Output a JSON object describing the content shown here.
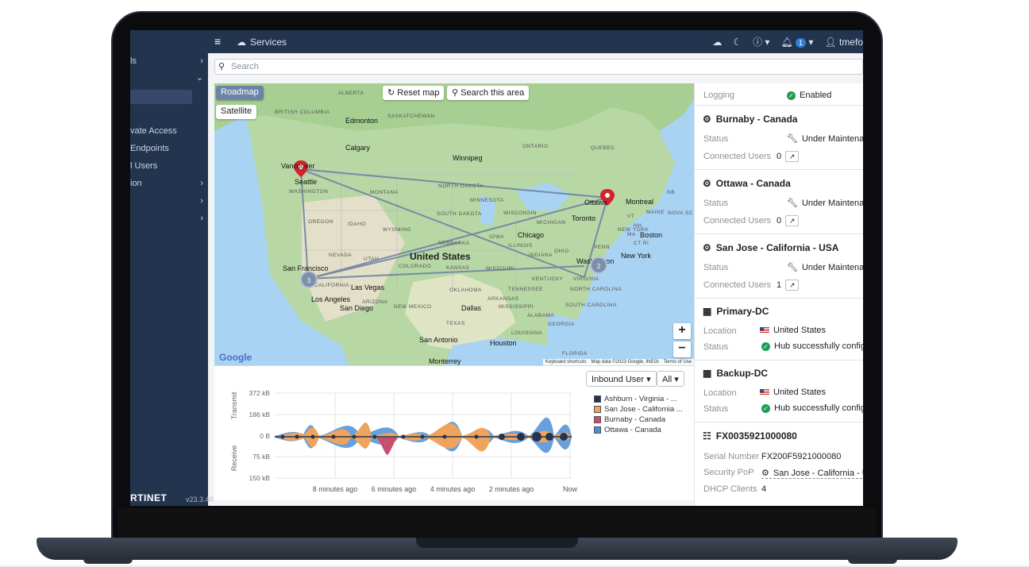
{
  "topbar": {
    "menu_icon": "hamburger-icon",
    "breadcrumb_icon": "cloud-icon",
    "breadcrumb": "Services",
    "notif_count": "1",
    "user": "tmefo"
  },
  "sidebar": {
    "items": [
      {
        "label": "ls",
        "chevron": "›"
      },
      {
        "label": "",
        "chevron": "⌄"
      },
      {
        "label": "vate Access",
        "chevron": ""
      },
      {
        "label": "Endpoints",
        "chevron": ""
      },
      {
        "label": "l Users",
        "chevron": ""
      },
      {
        "label": "ion",
        "chevron": "›"
      },
      {
        "label": "",
        "chevron": "›"
      },
      {
        "label": "",
        "chevron": "›"
      }
    ],
    "logo": "RTINET",
    "version": "v23.3.40"
  },
  "search": {
    "placeholder": "Search"
  },
  "map": {
    "roadmap": "Roadmap",
    "satellite": "Satellite",
    "reset": "Reset map",
    "search_area": "Search this area",
    "cluster_east": "2",
    "cluster_west": "3",
    "country": "United States",
    "cities": [
      "Vancouver",
      "Seattle",
      "Calgary",
      "Edmonton",
      "Winnipeg",
      "Ottawa",
      "Montreal",
      "Toronto",
      "Chicago",
      "Boston",
      "New York",
      "Washington",
      "San Francisco",
      "Las Vegas",
      "Los Angeles",
      "San Diego",
      "Dallas",
      "Houston",
      "San Antonio",
      "Monterrey"
    ],
    "regions": [
      "ALBERTA",
      "BRITISH COLUMBIA",
      "SASKATCHEWAN",
      "ONTARIO",
      "QUEBEC",
      "NORTH DAKOTA",
      "MINNESOTA",
      "MONTANA",
      "WASHINGTON",
      "OREGON",
      "IDAHO",
      "WYOMING",
      "SOUTH DAKOTA",
      "WISCONSIN",
      "MICHIGAN",
      "NEBRASKA",
      "IOWA",
      "ILLINOIS",
      "INDIANA",
      "OHIO",
      "PENN",
      "NEVADA",
      "UTAH",
      "COLORADO",
      "KANSAS",
      "MISSOURI",
      "KENTUCKY",
      "VIRGINIA",
      "ARIZONA",
      "NEW MEXICO",
      "OKLAHOMA",
      "ARKANSAS",
      "TENNESSEE",
      "NORTH CAROLINA",
      "SOUTH CAROLINA",
      "MISSISSIPPI",
      "ALABAMA",
      "GEORGIA",
      "TEXAS",
      "LOUISIANA",
      "FLORIDA",
      "CALIFORNIA",
      "NEW YORK",
      "MAINE",
      "NOVA SC",
      "VT",
      "NH",
      "CT RI",
      "MA",
      "NB"
    ],
    "footer": {
      "shortcuts": "Keyboard shortcuts",
      "data": "Map data ©2023 Google, INEGI",
      "terms": "Terms of Use"
    },
    "google": "Google"
  },
  "chart_controls": {
    "filter": "Inbound User ▾",
    "scope": "All ▾"
  },
  "chart_data": {
    "type": "area",
    "ylabel_top": "Transmit",
    "ylabel_bottom": "Receive",
    "y_ticks": [
      "372 kB",
      "186 kB",
      "0 B",
      "75 kB",
      "150 kB"
    ],
    "x_ticks": [
      "8 minutes ago",
      "6 minutes ago",
      "4 minutes ago",
      "2 minutes ago",
      "Now"
    ],
    "legend": [
      {
        "name": "Ashburn - Virginia - ...",
        "color": "#23344f"
      },
      {
        "name": "San Jose - California ...",
        "color": "#f0a35b"
      },
      {
        "name": "Burnaby - Canada",
        "color": "#c84d70"
      },
      {
        "name": "Ottawa - Canada",
        "color": "#4d8fd6"
      }
    ]
  },
  "panel": {
    "logging": {
      "label": "Logging",
      "value": "Enabled"
    },
    "burnaby": {
      "title": "Burnaby - Canada",
      "status_label": "Status",
      "status": "Under Maintenan",
      "users_label": "Connected Users",
      "users": "0"
    },
    "ottawa": {
      "title": "Ottawa - Canada",
      "status_label": "Status",
      "status": "Under Maintenan",
      "users_label": "Connected Users",
      "users": "0"
    },
    "sanjose": {
      "title": "San Jose - California - USA",
      "status_label": "Status",
      "status": "Under Maintenan",
      "users_label": "Connected Users",
      "users": "1"
    },
    "primary": {
      "title": "Primary-DC",
      "location_label": "Location",
      "location": "United States",
      "status_label": "Status",
      "status": "Hub successfully configu"
    },
    "backup": {
      "title": "Backup-DC",
      "location_label": "Location",
      "location": "United States",
      "status_label": "Status",
      "status": "Hub successfully configu"
    },
    "device": {
      "title": "FX0035921000080",
      "serial_label": "Serial Number",
      "serial": "FX200F5921000080",
      "pop_label": "Security PoP",
      "pop": "San Jose - California - US",
      "dhcp_label": "DHCP Clients",
      "dhcp": "4"
    }
  }
}
